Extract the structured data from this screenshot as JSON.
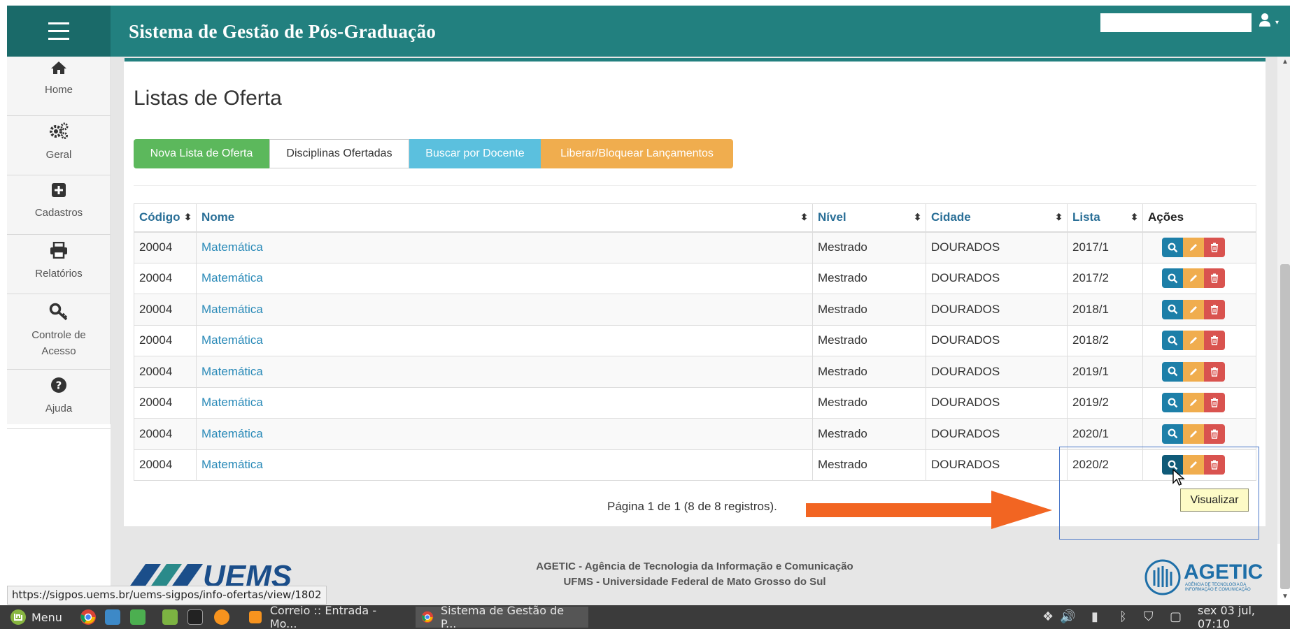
{
  "header": {
    "title": "Sistema de Gestão de Pós-Graduação",
    "menu_icon": "hamburger-icon",
    "user_icon": "user-icon"
  },
  "sidebar": {
    "items": [
      {
        "label": "Home",
        "icon": "home-icon"
      },
      {
        "label": "Geral",
        "icon": "gears-icon"
      },
      {
        "label": "Cadastros",
        "icon": "plus-square-icon"
      },
      {
        "label": "Relatórios",
        "icon": "printer-icon"
      },
      {
        "label": "Controle de",
        "label2": "Acesso",
        "icon": "key-icon"
      },
      {
        "label": "Ajuda",
        "icon": "question-circle-icon"
      }
    ]
  },
  "page": {
    "title": "Listas de Oferta",
    "buttons": {
      "nova": "Nova Lista de Oferta",
      "disciplinas": "Disciplinas Ofertadas",
      "buscar": "Buscar por Docente",
      "liberar": "Liberar/Bloquear Lançamentos"
    },
    "table": {
      "headers": [
        "Código",
        "Nome",
        "Nível",
        "Cidade",
        "Lista",
        "Ações"
      ],
      "rows": [
        {
          "codigo": "20004",
          "nome": "Matemática",
          "nivel": "Mestrado",
          "cidade": "DOURADOS",
          "lista": "2017/1"
        },
        {
          "codigo": "20004",
          "nome": "Matemática",
          "nivel": "Mestrado",
          "cidade": "DOURADOS",
          "lista": "2017/2"
        },
        {
          "codigo": "20004",
          "nome": "Matemática",
          "nivel": "Mestrado",
          "cidade": "DOURADOS",
          "lista": "2018/1"
        },
        {
          "codigo": "20004",
          "nome": "Matemática",
          "nivel": "Mestrado",
          "cidade": "DOURADOS",
          "lista": "2018/2"
        },
        {
          "codigo": "20004",
          "nome": "Matemática",
          "nivel": "Mestrado",
          "cidade": "DOURADOS",
          "lista": "2019/1"
        },
        {
          "codigo": "20004",
          "nome": "Matemática",
          "nivel": "Mestrado",
          "cidade": "DOURADOS",
          "lista": "2019/2"
        },
        {
          "codigo": "20004",
          "nome": "Matemática",
          "nivel": "Mestrado",
          "cidade": "DOURADOS",
          "lista": "2020/1"
        },
        {
          "codigo": "20004",
          "nome": "Matemática",
          "nivel": "Mestrado",
          "cidade": "DOURADOS",
          "lista": "2020/2"
        }
      ]
    },
    "pager": "Página 1 de 1 (8 de 8 registros).",
    "tooltip": "Visualizar"
  },
  "footer": {
    "logo_text": "UEMS",
    "line1": "AGETIC - Agência de Tecnologia da Informação e Comunicação",
    "line2": "UFMS - Universidade Federal de Mato Grosso do Sul",
    "agetic": "AGETIC",
    "agetic_sub1": "AGÊNCIA DE TECNOLOGIA DA",
    "agetic_sub2": "INFORMAÇÃO E COMUNICAÇÃO"
  },
  "status_url": "https://sigpos.uems.br/uems-sigpos/info-ofertas/view/1802",
  "taskbar": {
    "menu": "Menu",
    "tasks": [
      "Correio :: Entrada - Mo...",
      "Sistema de Gestão de P..."
    ],
    "clock": "sex 03 jul, 07:10"
  },
  "colors": {
    "header": "#22807f",
    "success": "#5cb85c",
    "info": "#5bc0de",
    "warning": "#f0ad4e",
    "danger": "#d9534f",
    "primary": "#1d7fa8",
    "annotation_arrow": "#f26522"
  }
}
